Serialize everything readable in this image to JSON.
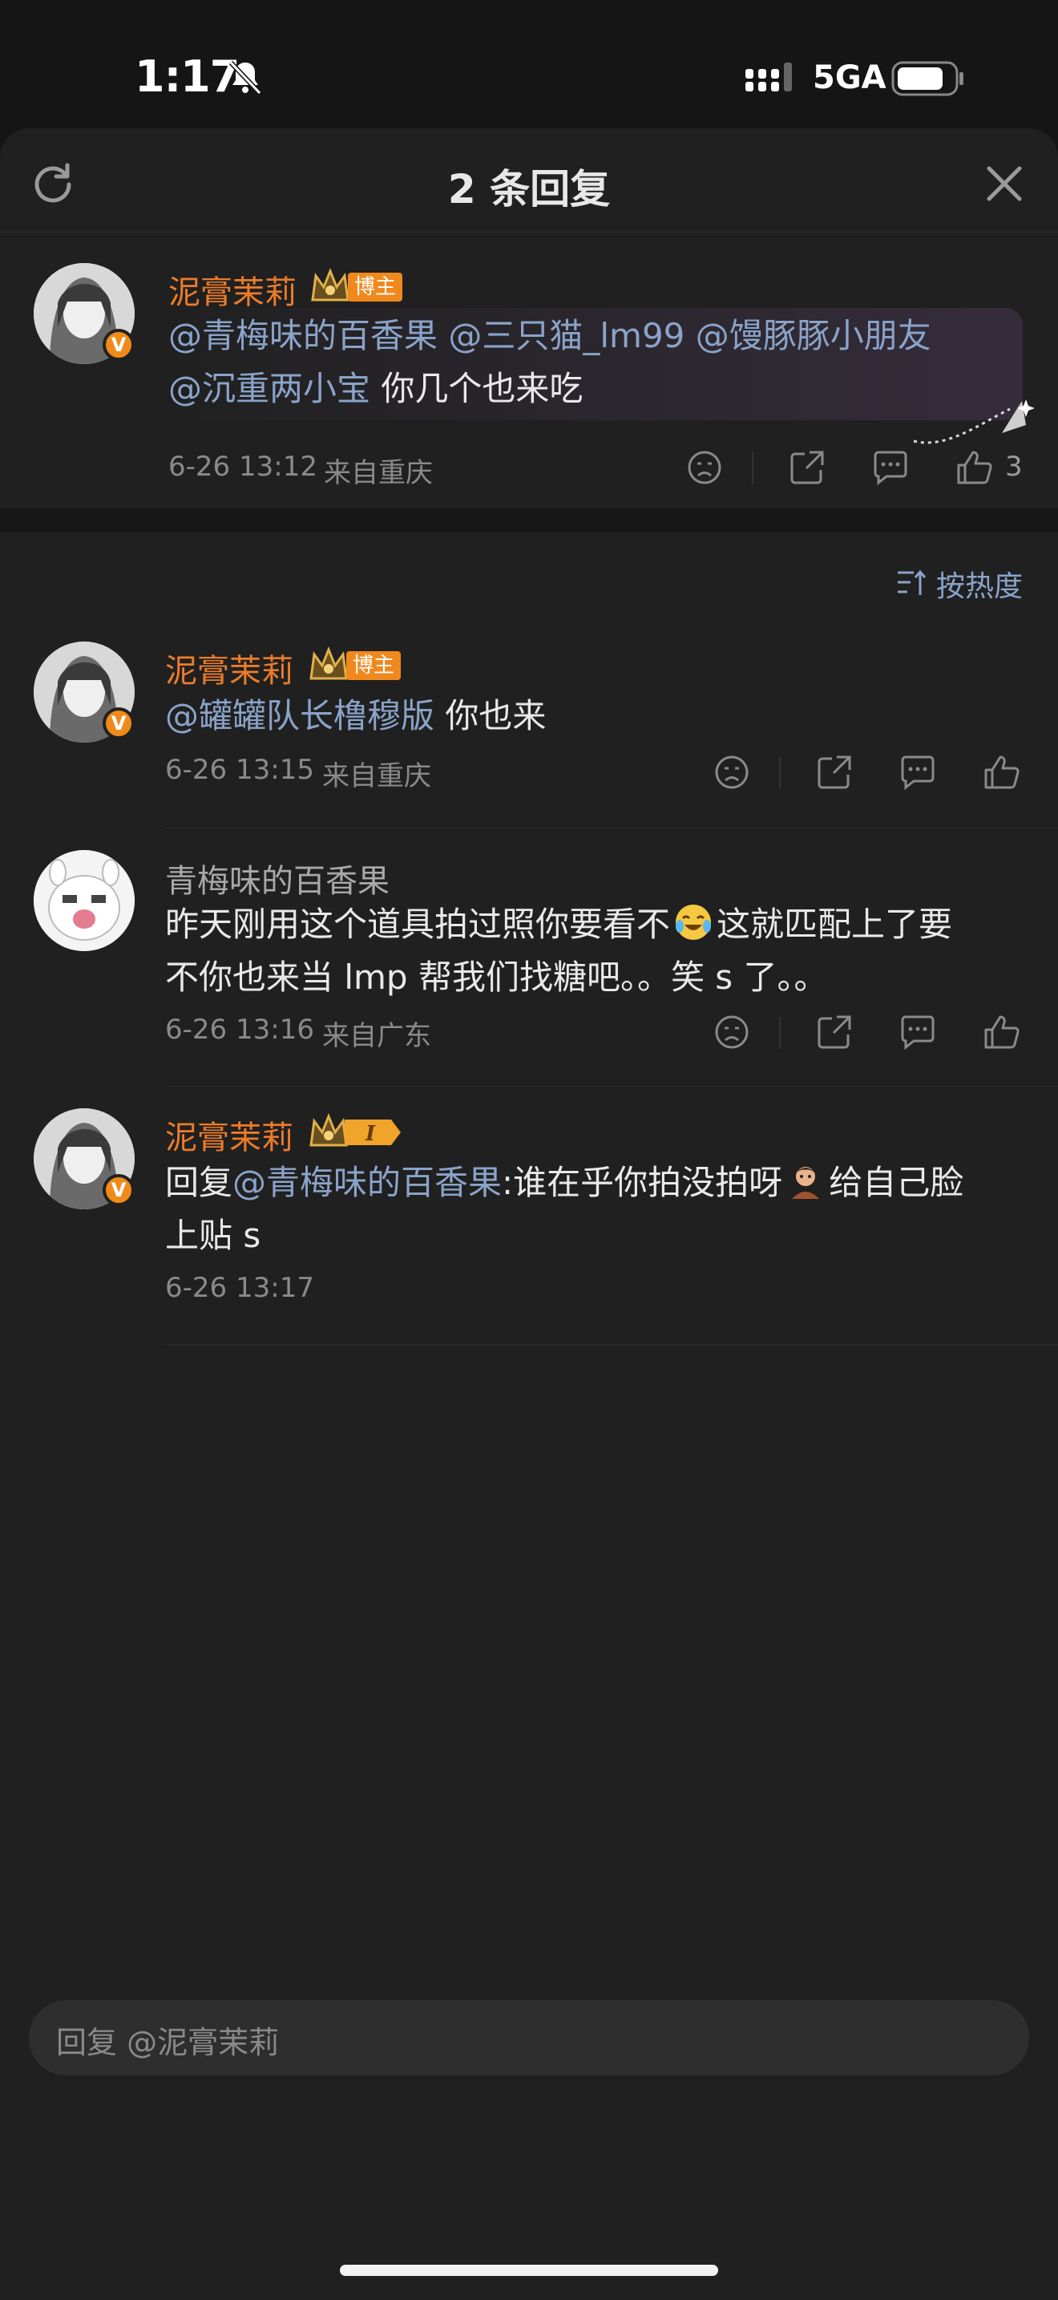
{
  "status_bar": {
    "time": "1:17",
    "network": "5GA",
    "icons": [
      "bell-muted-icon",
      "signal-icon",
      "battery-icon"
    ]
  },
  "sheet": {
    "title": "2 条回复",
    "icons": [
      "refresh-icon",
      "close-icon"
    ]
  },
  "root_comment": {
    "author": "泥膏茉莉",
    "author_tag": "博主",
    "mentions": [
      "@青梅味的百香果",
      "@三只猫_lm99",
      "@馒豚豚小朋友",
      "@沉重两小宝"
    ],
    "text": "你几个也来吃",
    "time": "6-26 13:12",
    "location": "来自重庆",
    "likes": "3"
  },
  "sort": {
    "label": "按热度",
    "icon": "sort-icon"
  },
  "replies": [
    {
      "author": "泥膏茉莉",
      "author_tag": "博主",
      "mention": "@罐罐队长橹穆版",
      "text": " 你也来",
      "time": "6-26 13:15",
      "location": "来自重庆"
    },
    {
      "author": "青梅味的百香果",
      "text_line1_a": "昨天刚用这个道具拍过照你要看不",
      "text_line1_b": "这就匹配上了要",
      "text_line2": "不你也来当 lmp 帮我们找糖吧。。笑 s 了。。",
      "time": "6-26 13:16",
      "location": "来自广东"
    },
    {
      "author": "泥膏茉莉",
      "prefix": "回复",
      "mention": "@青梅味的百香果",
      "text_a": ":谁在乎你拍没拍呀",
      "text_b": "给自己脸",
      "text_line2": "上贴 s",
      "time": "6-26 13:17"
    }
  ],
  "input": {
    "placeholder": "回复 @泥膏茉莉"
  },
  "colors": {
    "accent_name": "#ec7c2a",
    "mention": "#8aa3c9",
    "background": "#202020"
  }
}
